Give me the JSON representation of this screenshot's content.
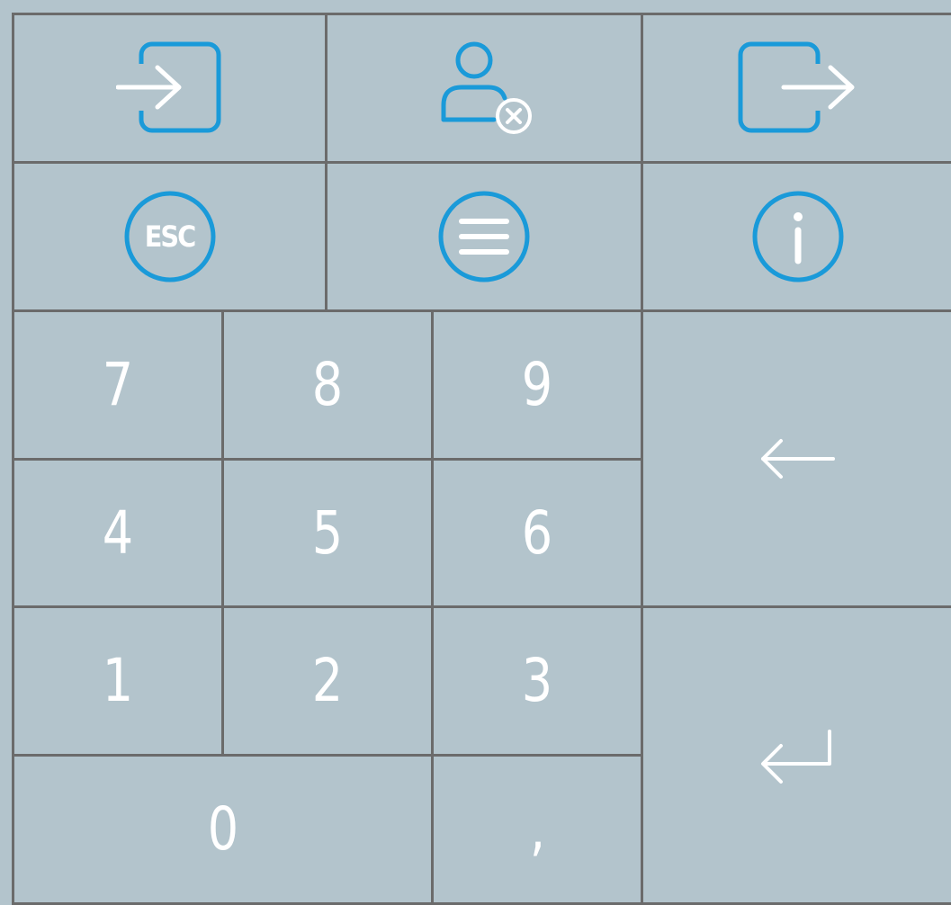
{
  "keypad": {
    "actions": {
      "login_icon": "login-icon",
      "user_remove_icon": "user-remove-icon",
      "logout_icon": "logout-icon",
      "esc_label": "ESC",
      "menu_icon": "menu-icon",
      "info_icon": "info-icon"
    },
    "digits": {
      "k7": "7",
      "k8": "8",
      "k9": "9",
      "k4": "4",
      "k5": "5",
      "k6": "6",
      "k1": "1",
      "k2": "2",
      "k3": "3",
      "k0": "0",
      "comma": ","
    },
    "side": {
      "backspace_icon": "backspace-arrow-icon",
      "enter_icon": "enter-return-icon"
    },
    "colors": {
      "background": "#b3c4cc",
      "border": "#6b6b6b",
      "accent": "#1a9ad9",
      "digit": "#ffffff"
    }
  }
}
